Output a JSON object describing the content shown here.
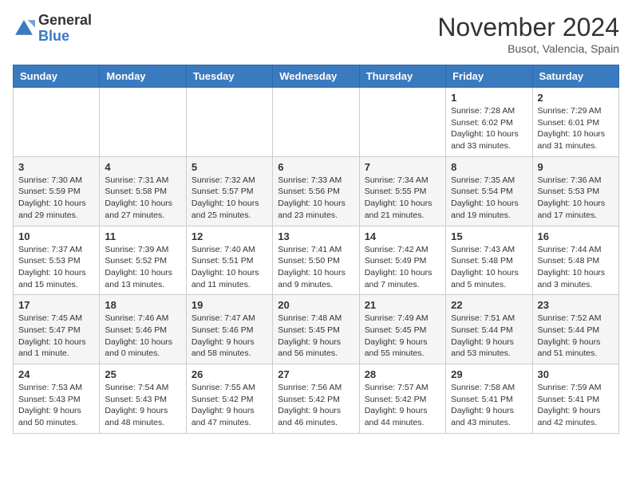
{
  "header": {
    "logo_general": "General",
    "logo_blue": "Blue",
    "month_title": "November 2024",
    "location": "Busot, Valencia, Spain"
  },
  "calendar": {
    "days_of_week": [
      "Sunday",
      "Monday",
      "Tuesday",
      "Wednesday",
      "Thursday",
      "Friday",
      "Saturday"
    ],
    "weeks": [
      [
        {
          "date": "",
          "info": ""
        },
        {
          "date": "",
          "info": ""
        },
        {
          "date": "",
          "info": ""
        },
        {
          "date": "",
          "info": ""
        },
        {
          "date": "",
          "info": ""
        },
        {
          "date": "1",
          "info": "Sunrise: 7:28 AM\nSunset: 6:02 PM\nDaylight: 10 hours and 33 minutes."
        },
        {
          "date": "2",
          "info": "Sunrise: 7:29 AM\nSunset: 6:01 PM\nDaylight: 10 hours and 31 minutes."
        }
      ],
      [
        {
          "date": "3",
          "info": "Sunrise: 7:30 AM\nSunset: 5:59 PM\nDaylight: 10 hours and 29 minutes."
        },
        {
          "date": "4",
          "info": "Sunrise: 7:31 AM\nSunset: 5:58 PM\nDaylight: 10 hours and 27 minutes."
        },
        {
          "date": "5",
          "info": "Sunrise: 7:32 AM\nSunset: 5:57 PM\nDaylight: 10 hours and 25 minutes."
        },
        {
          "date": "6",
          "info": "Sunrise: 7:33 AM\nSunset: 5:56 PM\nDaylight: 10 hours and 23 minutes."
        },
        {
          "date": "7",
          "info": "Sunrise: 7:34 AM\nSunset: 5:55 PM\nDaylight: 10 hours and 21 minutes."
        },
        {
          "date": "8",
          "info": "Sunrise: 7:35 AM\nSunset: 5:54 PM\nDaylight: 10 hours and 19 minutes."
        },
        {
          "date": "9",
          "info": "Sunrise: 7:36 AM\nSunset: 5:53 PM\nDaylight: 10 hours and 17 minutes."
        }
      ],
      [
        {
          "date": "10",
          "info": "Sunrise: 7:37 AM\nSunset: 5:53 PM\nDaylight: 10 hours and 15 minutes."
        },
        {
          "date": "11",
          "info": "Sunrise: 7:39 AM\nSunset: 5:52 PM\nDaylight: 10 hours and 13 minutes."
        },
        {
          "date": "12",
          "info": "Sunrise: 7:40 AM\nSunset: 5:51 PM\nDaylight: 10 hours and 11 minutes."
        },
        {
          "date": "13",
          "info": "Sunrise: 7:41 AM\nSunset: 5:50 PM\nDaylight: 10 hours and 9 minutes."
        },
        {
          "date": "14",
          "info": "Sunrise: 7:42 AM\nSunset: 5:49 PM\nDaylight: 10 hours and 7 minutes."
        },
        {
          "date": "15",
          "info": "Sunrise: 7:43 AM\nSunset: 5:48 PM\nDaylight: 10 hours and 5 minutes."
        },
        {
          "date": "16",
          "info": "Sunrise: 7:44 AM\nSunset: 5:48 PM\nDaylight: 10 hours and 3 minutes."
        }
      ],
      [
        {
          "date": "17",
          "info": "Sunrise: 7:45 AM\nSunset: 5:47 PM\nDaylight: 10 hours and 1 minute."
        },
        {
          "date": "18",
          "info": "Sunrise: 7:46 AM\nSunset: 5:46 PM\nDaylight: 10 hours and 0 minutes."
        },
        {
          "date": "19",
          "info": "Sunrise: 7:47 AM\nSunset: 5:46 PM\nDaylight: 9 hours and 58 minutes."
        },
        {
          "date": "20",
          "info": "Sunrise: 7:48 AM\nSunset: 5:45 PM\nDaylight: 9 hours and 56 minutes."
        },
        {
          "date": "21",
          "info": "Sunrise: 7:49 AM\nSunset: 5:45 PM\nDaylight: 9 hours and 55 minutes."
        },
        {
          "date": "22",
          "info": "Sunrise: 7:51 AM\nSunset: 5:44 PM\nDaylight: 9 hours and 53 minutes."
        },
        {
          "date": "23",
          "info": "Sunrise: 7:52 AM\nSunset: 5:44 PM\nDaylight: 9 hours and 51 minutes."
        }
      ],
      [
        {
          "date": "24",
          "info": "Sunrise: 7:53 AM\nSunset: 5:43 PM\nDaylight: 9 hours and 50 minutes."
        },
        {
          "date": "25",
          "info": "Sunrise: 7:54 AM\nSunset: 5:43 PM\nDaylight: 9 hours and 48 minutes."
        },
        {
          "date": "26",
          "info": "Sunrise: 7:55 AM\nSunset: 5:42 PM\nDaylight: 9 hours and 47 minutes."
        },
        {
          "date": "27",
          "info": "Sunrise: 7:56 AM\nSunset: 5:42 PM\nDaylight: 9 hours and 46 minutes."
        },
        {
          "date": "28",
          "info": "Sunrise: 7:57 AM\nSunset: 5:42 PM\nDaylight: 9 hours and 44 minutes."
        },
        {
          "date": "29",
          "info": "Sunrise: 7:58 AM\nSunset: 5:41 PM\nDaylight: 9 hours and 43 minutes."
        },
        {
          "date": "30",
          "info": "Sunrise: 7:59 AM\nSunset: 5:41 PM\nDaylight: 9 hours and 42 minutes."
        }
      ]
    ]
  }
}
